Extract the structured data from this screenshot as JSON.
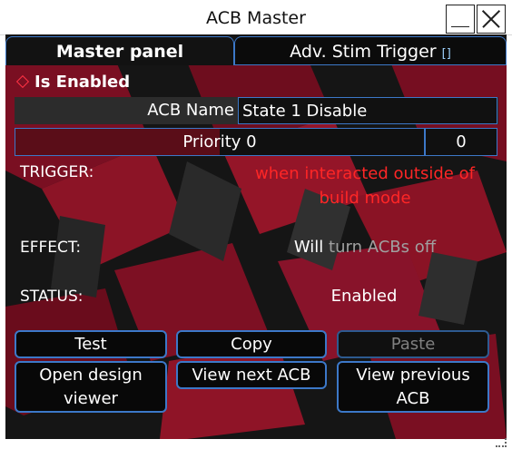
{
  "window": {
    "title": "ACB Master"
  },
  "tabs": {
    "master": "Master panel",
    "adv": "Adv. Stim Trigger",
    "adv_badge": "[]"
  },
  "enabled": {
    "label": "Is Enabled"
  },
  "acb_name": {
    "label": "ACB Name",
    "value": "State 1 Disable"
  },
  "priority": {
    "label": "Priority 0",
    "value": "0",
    "fill_fraction": 0.5
  },
  "trigger": {
    "label": "TRIGGER:",
    "value": "when interacted outside of build mode"
  },
  "effect": {
    "label": "EFFECT:",
    "will": "Will",
    "action": "turn ACBs off"
  },
  "status": {
    "label": "STATUS:",
    "value": "Enabled"
  },
  "buttons": {
    "test": "Test",
    "copy": "Copy",
    "paste": "Paste",
    "open_design": "Open design viewer",
    "view_next": "View next ACB",
    "view_prev": "View previous ACB"
  },
  "colors": {
    "accent": "#3c78c8",
    "trigger_text": "#ff2626",
    "priority_fill": "#5a0d18"
  }
}
